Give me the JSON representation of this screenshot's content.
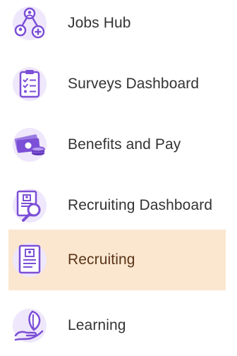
{
  "menu": {
    "items": [
      {
        "label": "Jobs Hub",
        "icon": "people-network-add-icon",
        "selected": false
      },
      {
        "label": "Surveys Dashboard",
        "icon": "clipboard-checklist-icon",
        "selected": false
      },
      {
        "label": "Benefits and Pay",
        "icon": "money-coins-icon",
        "selected": false
      },
      {
        "label": "Recruiting Dashboard",
        "icon": "resume-search-icon",
        "selected": false
      },
      {
        "label": "Recruiting",
        "icon": "resume-document-icon",
        "selected": true
      },
      {
        "label": "Learning",
        "icon": "hand-leaf-icon",
        "selected": false
      }
    ]
  },
  "colors": {
    "icon_purple": "#7b4fd6",
    "icon_bg": "#efe7fb",
    "selected_bg": "#fbe6cf",
    "label_text": "#333333",
    "selected_label_text": "#5a3518"
  }
}
